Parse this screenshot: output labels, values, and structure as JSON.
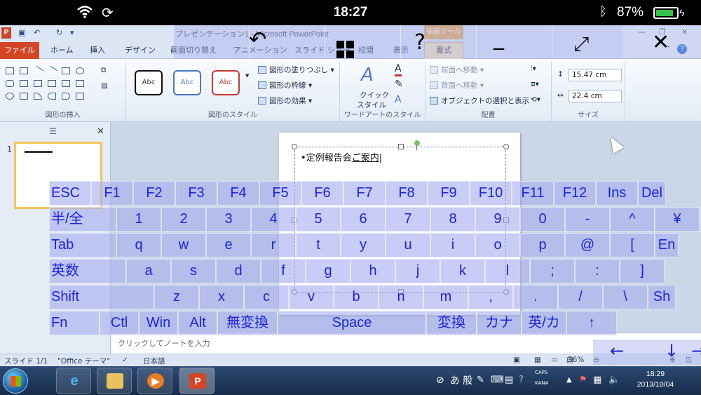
{
  "ios_status": {
    "time": "18:27",
    "battery_pct": "87%",
    "battery_level": 0.87
  },
  "window": {
    "title": "プレゼンテーション1 - Microsoft PowerPoint",
    "contextual_tool": "描画ツール"
  },
  "tabs": {
    "file": "ファイル",
    "home": "ホーム",
    "insert": "挿入",
    "design": "デザイン",
    "transitions": "画面切り替え",
    "animations": "アニメーション",
    "slideshow": "スライド ショー",
    "review": "校閲",
    "view": "表示",
    "format": "書式"
  },
  "ribbon": {
    "group_insert_shapes": "図形の挿入",
    "group_shape_styles": "図形のスタイル",
    "group_wordart": "ワードアートのスタイル",
    "group_arrange": "配置",
    "group_size": "サイズ",
    "style_sample": "Abc",
    "shape_fill": "図形の塗りつぶし",
    "shape_outline": "図形の枠線",
    "shape_effects": "図形の効果",
    "quick_styles_1": "クイック",
    "quick_styles_2": "スタイル",
    "bring_forward": "前面へ移動",
    "send_backward": "背面へ移動",
    "selection_pane": "オブジェクトの選択と表示",
    "height": "15.47 cm",
    "width": "22.4 cm",
    "text_fill_letter": "A"
  },
  "slides_pane": {
    "slide_number": "1"
  },
  "slide": {
    "text_prefix": "定例報告会",
    "text_underlined": "ご案内"
  },
  "notes_placeholder": "クリックしてノートを入力",
  "statusbar": {
    "slide": "スライド 1/1",
    "theme": "\"Office テーマ\"",
    "lang": "日本語",
    "zoom": "36%"
  },
  "taskbar": {
    "ime_a": "あ",
    "ime_mode": "般",
    "caps": "CAPS",
    "kana": "KANA",
    "time": "18:29",
    "date": "2013/10/04"
  },
  "keyboard": {
    "row1": [
      "ESC",
      "F1",
      "F2",
      "F3",
      "F4",
      "F5",
      "F6",
      "F7",
      "F8",
      "F9",
      "F10",
      "F11",
      "F12",
      "Ins",
      "Del"
    ],
    "row2": [
      "半/全",
      "1",
      "2",
      "3",
      "4",
      "5",
      "6",
      "7",
      "8",
      "9",
      "0",
      "-",
      "^",
      "¥"
    ],
    "row3": [
      "Tab",
      "q",
      "w",
      "e",
      "r",
      "t",
      "y",
      "u",
      "i",
      "o",
      "p",
      "@",
      "[",
      "En"
    ],
    "row4": [
      "英数",
      "a",
      "s",
      "d",
      "f",
      "g",
      "h",
      "j",
      "k",
      "l",
      ";",
      ":",
      "]"
    ],
    "row5": [
      "Shift",
      "z",
      "x",
      "c",
      "v",
      "b",
      "n",
      "m",
      ",",
      ".",
      "/",
      "\\",
      "Sh"
    ],
    "row6": [
      "Fn",
      "Ctl",
      "Win",
      "Alt",
      "無変換",
      "Space",
      "変換",
      "カナ",
      "英/カ",
      "↑"
    ],
    "arrows": [
      "←",
      "↓",
      "→"
    ]
  },
  "colors": {
    "file_tab": "#d24625",
    "key_text": "#1a26d4",
    "key_bg": "#a8acee",
    "taskbar": "#1f3a60",
    "accent_selection": "#f3c75b"
  }
}
